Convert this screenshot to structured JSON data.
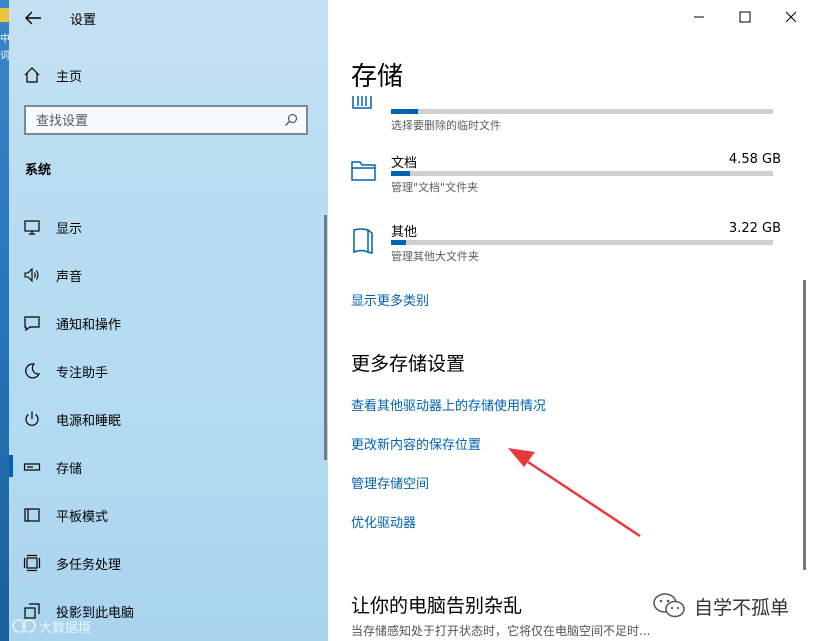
{
  "window": {
    "title": "设置",
    "controls": {
      "minimize": "minimize",
      "maximize": "maximize",
      "close": "close"
    }
  },
  "sidebar": {
    "home_label": "主页",
    "search_placeholder": "查找设置",
    "section_label": "系统",
    "items": [
      {
        "label": "显示",
        "icon": "monitor-icon"
      },
      {
        "label": "声音",
        "icon": "speaker-icon"
      },
      {
        "label": "通知和操作",
        "icon": "notification-icon"
      },
      {
        "label": "专注助手",
        "icon": "moon-icon"
      },
      {
        "label": "电源和睡眠",
        "icon": "power-icon"
      },
      {
        "label": "存储",
        "icon": "storage-drive-icon",
        "selected": true
      },
      {
        "label": "平板模式",
        "icon": "tablet-icon"
      },
      {
        "label": "多任务处理",
        "icon": "multitask-icon"
      },
      {
        "label": "投影到此电脑",
        "icon": "project-icon"
      }
    ]
  },
  "main": {
    "page_title": "存储",
    "storage_items": [
      {
        "name": "",
        "size": "",
        "desc": "选择要删除的临时文件",
        "fill_pct": 7,
        "icon": "trash-icon"
      },
      {
        "name": "文档",
        "size": "4.58 GB",
        "desc": "管理\"文档\"文件夹",
        "fill_pct": 5,
        "icon": "folder-icon"
      },
      {
        "name": "其他",
        "size": "3.22 GB",
        "desc": "管理其他大文件夹",
        "fill_pct": 4,
        "icon": "file-icon"
      }
    ],
    "show_more_link": "显示更多类别",
    "more_heading": "更多存储设置",
    "links": [
      "查看其他驱动器上的存储使用情况",
      "更改新内容的保存位置",
      "管理存储空间",
      "优化驱动器"
    ],
    "declutter_heading": "让你的电脑告别杂乱",
    "declutter_text": "当存储感知处于打开状态时，它将仅在电脑空间不足时..."
  },
  "desktop": {
    "line1": "中",
    "line2": "词"
  },
  "watermarks": {
    "left": "大数据境",
    "right": "自学不孤单"
  },
  "colors": {
    "accent": "#0063b1",
    "annotation_arrow": "#e8393a"
  }
}
